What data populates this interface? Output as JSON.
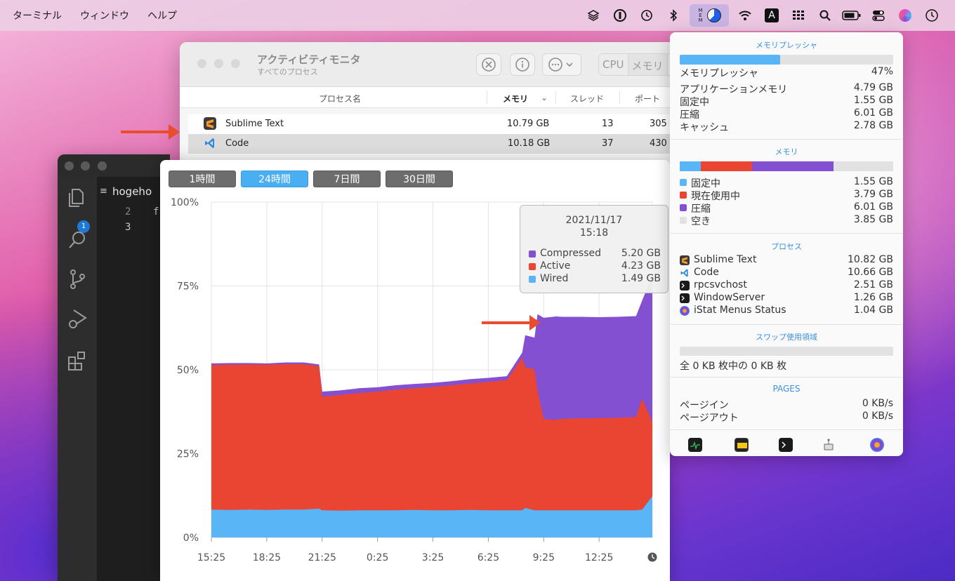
{
  "menubar": {
    "items": [
      "ターミナル",
      "ウィンドウ",
      "ヘルプ"
    ],
    "mem_label": [
      "M",
      "E",
      "M"
    ],
    "input_label": "A"
  },
  "activity_monitor": {
    "title": "アクティビティモニタ",
    "subtitle": "すべてのプロセス",
    "tabs": [
      "CPU",
      "メモリ"
    ],
    "columns": [
      "プロセス名",
      "メモリ",
      "スレッド",
      "ポート"
    ],
    "rows": [
      {
        "name": "Sublime Text",
        "memory": "10.79 GB",
        "threads": "13",
        "ports": "305"
      },
      {
        "name": "Code",
        "memory": "10.18 GB",
        "threads": "37",
        "ports": "430"
      }
    ]
  },
  "vscode": {
    "tab_label": "hogeho",
    "badge": "1",
    "line_numbers": [
      "2",
      "3"
    ],
    "line_text": "f"
  },
  "history": {
    "ranges": [
      "1時間",
      "24時間",
      "7日間",
      "30日間"
    ],
    "active_range": "24時間",
    "tooltip": {
      "date": "2021/11/17",
      "time": "15:18",
      "items": [
        {
          "name": "Compressed",
          "value": "5.20 GB",
          "color": "#8350d2"
        },
        {
          "name": "Active",
          "value": "4.23 GB",
          "color": "#ea4533"
        },
        {
          "name": "Wired",
          "value": "1.49 GB",
          "color": "#5ab5f7"
        }
      ]
    }
  },
  "chart_data": {
    "type": "area",
    "stacked": true,
    "x": [
      "15:25",
      "16:25",
      "17:25",
      "18:25",
      "19:25",
      "20:25",
      "21:15",
      "21:25",
      "22:25",
      "23:25",
      "0:25",
      "1:25",
      "2:25",
      "3:25",
      "4:25",
      "5:25",
      "6:25",
      "7:25",
      "8:15",
      "8:25",
      "8:55",
      "9:05",
      "9:25",
      "10:05",
      "10:25",
      "11:25",
      "12:25",
      "13:25",
      "14:25",
      "14:45",
      "15:18"
    ],
    "xticks": [
      "15:25",
      "18:25",
      "21:25",
      "0:25",
      "3:25",
      "6:25",
      "9:25",
      "12:25"
    ],
    "yticks": [
      "100%",
      "75%",
      "50%",
      "25%",
      "0%"
    ],
    "ylim": [
      0,
      100
    ],
    "series": [
      {
        "name": "Wired",
        "color": "#5ab5f7",
        "values": [
          8.3,
          8.2,
          8.3,
          8.2,
          8.3,
          8.3,
          8.6,
          8.1,
          8.0,
          8.1,
          8.1,
          8.1,
          8.2,
          8.1,
          8.1,
          8.2,
          8.1,
          8.1,
          8.1,
          8.8,
          8.1,
          8.1,
          8.1,
          8.1,
          8.1,
          8.1,
          8.1,
          8.1,
          8.1,
          8.3,
          12.3
        ]
      },
      {
        "name": "Active",
        "color": "#ea4533",
        "values": [
          43.1,
          43.3,
          43.3,
          43.3,
          43.4,
          43.4,
          42.5,
          33.9,
          34.5,
          35.0,
          35.4,
          36.0,
          36.3,
          36.8,
          37.3,
          37.7,
          38.3,
          38.8,
          45.5,
          42.0,
          42.0,
          35.7,
          27.2,
          27.0,
          27.3,
          27.4,
          27.5,
          27.6,
          27.8,
          33.1,
          22.0
        ]
      },
      {
        "name": "Compressed",
        "color": "#8350d2",
        "values": [
          0.5,
          0.5,
          0.4,
          0.4,
          0.5,
          0.5,
          0.5,
          1.5,
          1.4,
          1.4,
          1.3,
          1.3,
          1.3,
          1.2,
          1.2,
          1.3,
          1.2,
          1.2,
          1.5,
          9.5,
          9.5,
          22.8,
          30.2,
          30.8,
          30.4,
          30.3,
          30.1,
          30.1,
          30.1,
          29.3,
          43.7
        ]
      }
    ]
  },
  "istat": {
    "pressure_title": "メモリプレッシャ",
    "pressure_label": "メモリプレッシャ",
    "pressure_value": "47%",
    "pressure_fraction": 0.47,
    "stats": [
      {
        "label": "アプリケーションメモリ",
        "value": "4.79 GB"
      },
      {
        "label": "固定中",
        "value": "1.55 GB"
      },
      {
        "label": "圧縮",
        "value": "6.01 GB"
      },
      {
        "label": "キャッシュ",
        "value": "2.78 GB"
      }
    ],
    "memory_title": "メモリ",
    "memory_legend": [
      {
        "label": "固定中",
        "value": "1.55 GB",
        "color": "#5ab5f7",
        "fraction": 0.1
      },
      {
        "label": "現在使用中",
        "value": "3.79 GB",
        "color": "#ea4533",
        "fraction": 0.24
      },
      {
        "label": "圧縮",
        "value": "6.01 GB",
        "color": "#8350d2",
        "fraction": 0.38
      },
      {
        "label": "空き",
        "value": "3.85 GB",
        "color": "#e2e2e2",
        "fraction": 0.28
      }
    ],
    "process_title": "プロセス",
    "processes": [
      {
        "name": "Sublime Text",
        "value": "10.82 GB"
      },
      {
        "name": "Code",
        "value": "10.66 GB"
      },
      {
        "name": "rpcsvchost",
        "value": "2.51 GB"
      },
      {
        "name": "WindowServer",
        "value": "1.26 GB"
      },
      {
        "name": "iStat Menus Status",
        "value": "1.04 GB"
      }
    ],
    "swap_title": "スワップ使用領域",
    "swap_text": "全 0 KB 枚中の 0 KB 枚",
    "pages_title": "PAGES",
    "pages": [
      {
        "label": "ページイン",
        "value": "0 KB/s"
      },
      {
        "label": "ページアウト",
        "value": "0 KB/s"
      }
    ]
  }
}
